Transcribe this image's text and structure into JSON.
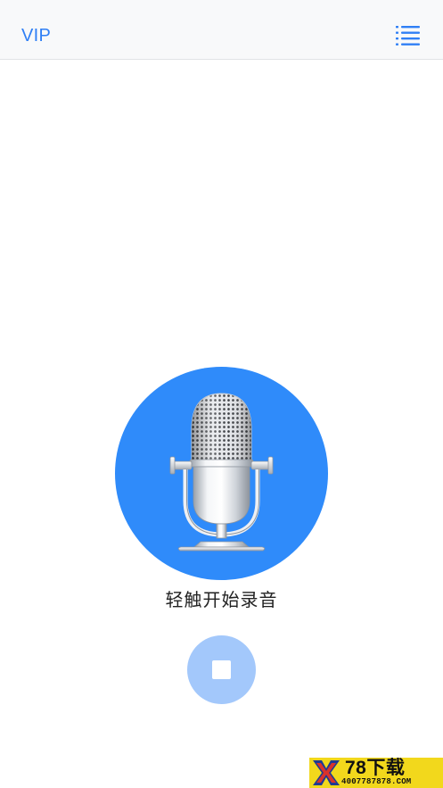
{
  "navbar": {
    "vip_label": "VIP",
    "menu_icon": "list-menu-icon"
  },
  "recorder": {
    "mic_icon": "microphone-icon",
    "hint": "轻触开始录音",
    "stop_icon": "stop-icon"
  },
  "watermark": {
    "logo_icon": "x-logo-icon",
    "title": "78下载",
    "url": "4007787878.COM"
  },
  "colors": {
    "accent": "#2f7ff5",
    "mic_circle": "#2f8bfa",
    "stop_button": "#a3c8fb",
    "navbar_bg": "#f8f9fa",
    "watermark_bg": "#f2d81c"
  }
}
